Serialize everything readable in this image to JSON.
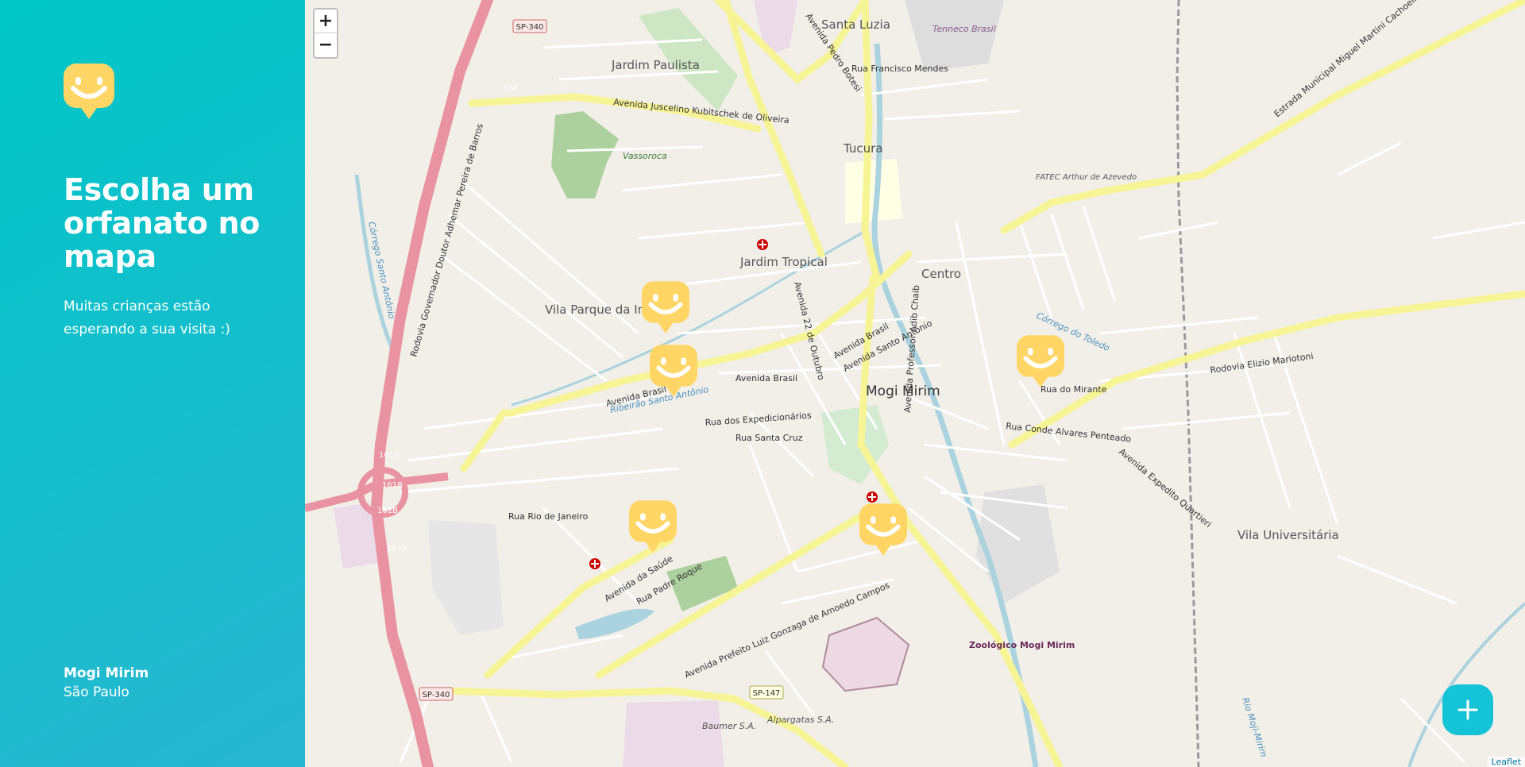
{
  "sidebar": {
    "title": "Escolha um orfanato no mapa",
    "subtitle": "Muitas crianças estão esperando a sua visita :)",
    "city": "Mogi Mirim",
    "state": "São Paulo",
    "logo_icon": "happy-face-marker-icon"
  },
  "map": {
    "zoom_in_label": "+",
    "zoom_out_label": "−",
    "attribution": "Leaflet",
    "fab_icon": "plus-icon",
    "marker_icon": "happy-face-marker-icon",
    "marker_count": 5,
    "colors": {
      "sidebar_gradient_start": "#29B6D1",
      "sidebar_gradient_end": "#00C7C7",
      "marker": "#FFD666",
      "fab": "#15C3D6",
      "motorway": "#e892a2",
      "primary_road": "#f9f7b6",
      "river": "#aad3df",
      "park": "#add19e"
    },
    "labels": {
      "santa_luzia": "Santa Luzia",
      "tenneco": "Tenneco Brasil",
      "jardim_paulista": "Jardim Paulista",
      "vassoroca": "Vassoroca",
      "tucura": "Tucura",
      "jardim_tropical": "Jardim Tropical",
      "centro": "Centro",
      "vila_parque": "Vila Parque da Imprensa",
      "mogi_mirim": "Mogi Mirim",
      "fatec": "FATEC Arthur de Azevedo",
      "vila_universitaria": "Vila Universitária",
      "zoologico": "Zoológico Mogi Mirim",
      "baumer": "Baumer S.A.",
      "alpargatas": "Alpargatas S.A.",
      "sp340_top": "SP-340",
      "sp340_bottom": "SP-340",
      "sp147": "SP-147",
      "av_jk": "Avenida Juscelino Kubitschek de Oliveira",
      "av_brasil_1": "Avenida Brasil",
      "av_brasil_2": "Avenida Brasil",
      "av_brasil_3": "Avenida Brasil",
      "av_saude": "Avenida da Saúde",
      "av_adib_chaib": "Avenida Professor Adib Chaib",
      "rod_elizio": "Rodovia Elizio Mariotoni",
      "estrada": "Estrada Municipal Miguel Martini Cachoeira",
      "rodovia_gov": "Rodovia Governador Doutor Adhemar Pereira de Barros",
      "av_prefeito": "Avenida Prefeito Luiz Gonzaga de Amoedo Campos",
      "rua_padre_roque": "Rua Padre Roque",
      "rua_mirante": "Rua do Mirante",
      "corrego_toledo": "Córrego do Toledo",
      "rio_moji": "Rio Moji-Mirim",
      "ribeirao": "Ribeirão Santo Antônio",
      "av_pedro_botesi": "Avenida Pedro Botesi",
      "rua_francisco_mendes": "Rua Francisco Mendes",
      "av_22_outubro": "Avenida 22 de Outubro",
      "av_santo_antonio": "Avenida Santo Antônio",
      "rua_santa_cruz": "Rua Santa Cruz",
      "rua_rio_janeiro": "Rua Rio de Janeiro",
      "rua_expedicionarios": "Rua dos Expedicionários",
      "av_expedito": "Avenida Expedito Quartieri",
      "rua_conde": "Rua Conde Alvares Penteado",
      "corrego_santo": "Córrego Santo Antônio",
      "r161a": "161A",
      "r161b": "161B",
      "r161b2": "161B",
      "r161a2": "161A",
      "r164": "164"
    }
  }
}
